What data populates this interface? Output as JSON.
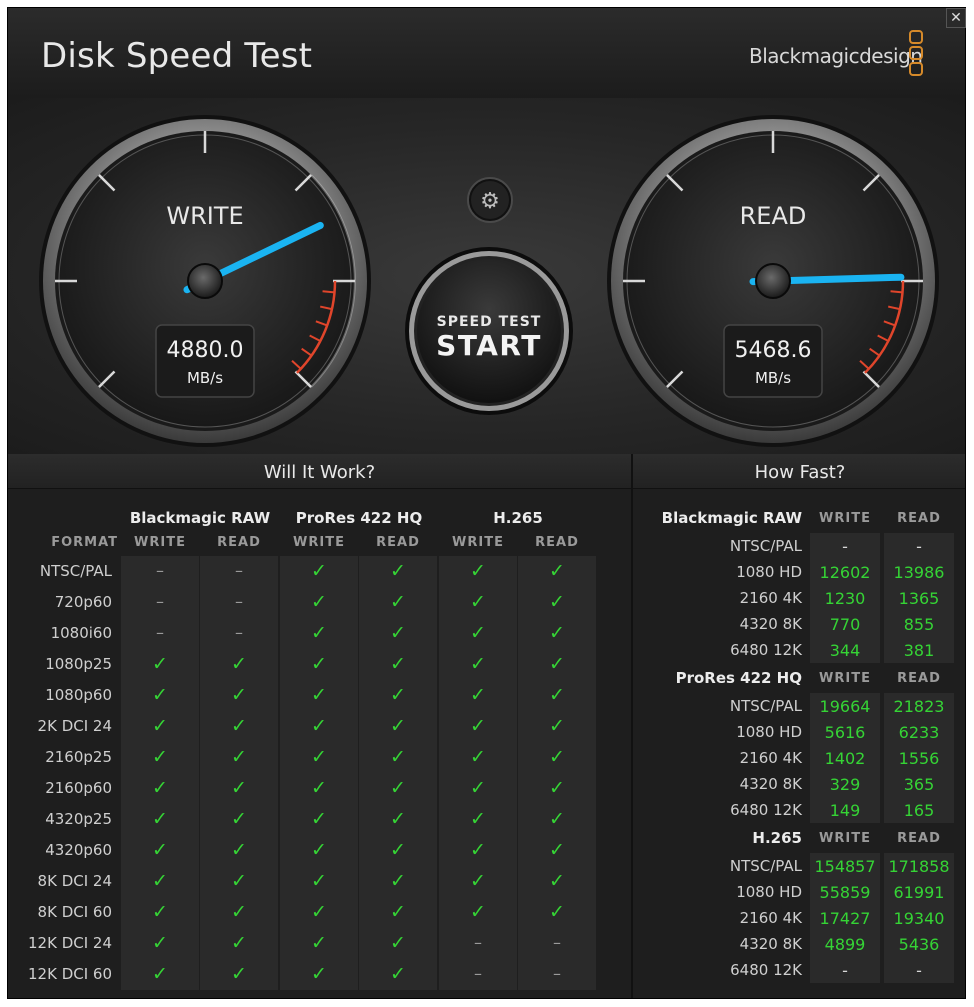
{
  "app": {
    "title": "Disk Speed Test",
    "brand": "Blackmagicdesign",
    "close_label": "✕"
  },
  "gauges": {
    "write": {
      "label": "WRITE",
      "value": "4880.0",
      "unit": "MB/s",
      "speed_mbps": 4880.0
    },
    "read": {
      "label": "READ",
      "value": "5468.6",
      "unit": "MB/s",
      "speed_mbps": 5468.6
    },
    "start_button": {
      "line1": "SPEED TEST",
      "line2": "START"
    },
    "settings_icon": "gear-icon",
    "needle_color": "#1ab4f2",
    "redline_color": "#e0452b"
  },
  "will_it_work": {
    "title": "Will It Work?",
    "format_header": "FORMAT",
    "groups": [
      "Blackmagic RAW",
      "ProRes 422 HQ",
      "H.265"
    ],
    "subheaders": [
      "WRITE",
      "READ",
      "WRITE",
      "READ",
      "WRITE",
      "READ"
    ],
    "rows": [
      {
        "format": "NTSC/PAL",
        "cells": [
          "–",
          "–",
          "✓",
          "✓",
          "✓",
          "✓"
        ]
      },
      {
        "format": "720p60",
        "cells": [
          "–",
          "–",
          "✓",
          "✓",
          "✓",
          "✓"
        ]
      },
      {
        "format": "1080i60",
        "cells": [
          "–",
          "–",
          "✓",
          "✓",
          "✓",
          "✓"
        ]
      },
      {
        "format": "1080p25",
        "cells": [
          "✓",
          "✓",
          "✓",
          "✓",
          "✓",
          "✓"
        ]
      },
      {
        "format": "1080p60",
        "cells": [
          "✓",
          "✓",
          "✓",
          "✓",
          "✓",
          "✓"
        ]
      },
      {
        "format": "2K DCI 24",
        "cells": [
          "✓",
          "✓",
          "✓",
          "✓",
          "✓",
          "✓"
        ]
      },
      {
        "format": "2160p25",
        "cells": [
          "✓",
          "✓",
          "✓",
          "✓",
          "✓",
          "✓"
        ]
      },
      {
        "format": "2160p60",
        "cells": [
          "✓",
          "✓",
          "✓",
          "✓",
          "✓",
          "✓"
        ]
      },
      {
        "format": "4320p25",
        "cells": [
          "✓",
          "✓",
          "✓",
          "✓",
          "✓",
          "✓"
        ]
      },
      {
        "format": "4320p60",
        "cells": [
          "✓",
          "✓",
          "✓",
          "✓",
          "✓",
          "✓"
        ]
      },
      {
        "format": "8K DCI 24",
        "cells": [
          "✓",
          "✓",
          "✓",
          "✓",
          "✓",
          "✓"
        ]
      },
      {
        "format": "8K DCI 60",
        "cells": [
          "✓",
          "✓",
          "✓",
          "✓",
          "✓",
          "✓"
        ]
      },
      {
        "format": "12K DCI 24",
        "cells": [
          "✓",
          "✓",
          "✓",
          "✓",
          "–",
          "–"
        ]
      },
      {
        "format": "12K DCI 60",
        "cells": [
          "✓",
          "✓",
          "✓",
          "✓",
          "–",
          "–"
        ]
      }
    ]
  },
  "how_fast": {
    "title": "How Fast?",
    "sections": [
      {
        "codec": "Blackmagic RAW",
        "headers": [
          "WRITE",
          "READ"
        ],
        "rows": [
          {
            "format": "NTSC/PAL",
            "write": "-",
            "read": "-"
          },
          {
            "format": "1080 HD",
            "write": "12602",
            "read": "13986"
          },
          {
            "format": "2160 4K",
            "write": "1230",
            "read": "1365"
          },
          {
            "format": "4320 8K",
            "write": "770",
            "read": "855"
          },
          {
            "format": "6480 12K",
            "write": "344",
            "read": "381"
          }
        ]
      },
      {
        "codec": "ProRes 422 HQ",
        "headers": [
          "WRITE",
          "READ"
        ],
        "rows": [
          {
            "format": "NTSC/PAL",
            "write": "19664",
            "read": "21823"
          },
          {
            "format": "1080 HD",
            "write": "5616",
            "read": "6233"
          },
          {
            "format": "2160 4K",
            "write": "1402",
            "read": "1556"
          },
          {
            "format": "4320 8K",
            "write": "329",
            "read": "365"
          },
          {
            "format": "6480 12K",
            "write": "149",
            "read": "165"
          }
        ]
      },
      {
        "codec": "H.265",
        "headers": [
          "WRITE",
          "READ"
        ],
        "rows": [
          {
            "format": "NTSC/PAL",
            "write": "154857",
            "read": "171858"
          },
          {
            "format": "1080 HD",
            "write": "55859",
            "read": "61991"
          },
          {
            "format": "2160 4K",
            "write": "17427",
            "read": "19340"
          },
          {
            "format": "4320 8K",
            "write": "4899",
            "read": "5436"
          },
          {
            "format": "6480 12K",
            "write": "-",
            "read": "-"
          }
        ]
      }
    ]
  }
}
